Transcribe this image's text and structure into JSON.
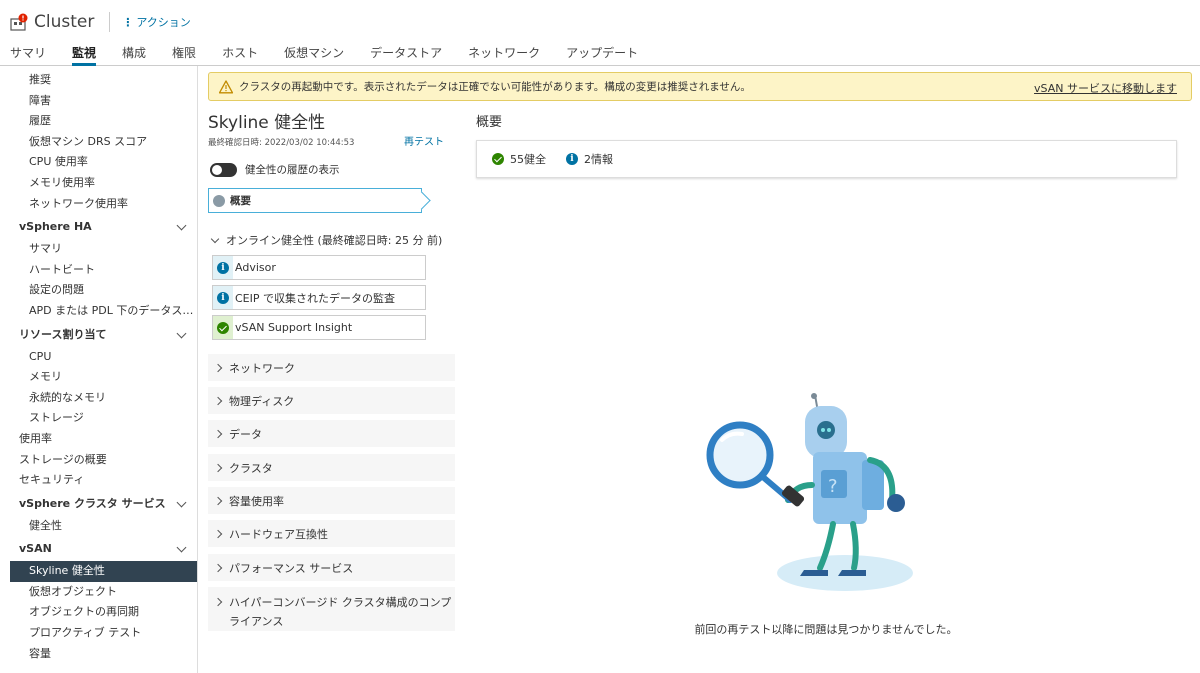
{
  "header": {
    "title": "Cluster",
    "actions_label": "アクション",
    "tabs": [
      {
        "label": "サマリ",
        "active": false
      },
      {
        "label": "監視",
        "active": true
      },
      {
        "label": "構成",
        "active": false
      },
      {
        "label": "権限",
        "active": false
      },
      {
        "label": "ホスト",
        "active": false
      },
      {
        "label": "仮想マシン",
        "active": false
      },
      {
        "label": "データストア",
        "active": false
      },
      {
        "label": "ネットワーク",
        "active": false
      },
      {
        "label": "アップデート",
        "active": false
      }
    ]
  },
  "sidebar": {
    "items_top": [
      "推奨",
      "障害",
      "履歴",
      "仮想マシン DRS スコア",
      "CPU 使用率",
      "メモリ使用率",
      "ネットワーク使用率"
    ],
    "section_ha": "vSphere HA",
    "items_ha": [
      "サマリ",
      "ハートビート",
      "設定の問題",
      "APD または PDL 下のデータストア"
    ],
    "section_resource": "リソース割り当て",
    "items_resource": [
      "CPU",
      "メモリ",
      "永続的なメモリ",
      "ストレージ"
    ],
    "items_misc": [
      "使用率",
      "ストレージの概要",
      "セキュリティ"
    ],
    "section_cluster_services": "vSphere クラスタ サービス",
    "items_cluster_services": [
      "健全性"
    ],
    "section_vsan": "vSAN",
    "items_vsan": [
      "Skyline 健全性",
      "仮想オブジェクト",
      "オブジェクトの再同期",
      "プロアクティブ テスト",
      "容量"
    ],
    "selected": "Skyline 健全性"
  },
  "banner": {
    "message": "クラスタの再起動中です。表示されたデータは正確でない可能性があります。構成の変更は推奨されません。",
    "link": "vSAN サービスに移動します",
    "color": "#fdf4c7"
  },
  "health": {
    "title": "Skyline 健全性",
    "last_checked": "最終確認日時: 2022/03/02 10:44:53",
    "retest": "再テスト",
    "history_toggle": "健全性の履歴の表示",
    "overview": "概要",
    "online_header": "オンライン健全性 (最終確認日時: 25 分 前)",
    "online_checks": [
      {
        "label": "Advisor",
        "status": "info"
      },
      {
        "label": "CEIP で収集されたデータの監査",
        "status": "info"
      },
      {
        "label": "vSAN Support Insight",
        "status": "ok"
      }
    ],
    "groups": [
      "ネットワーク",
      "物理ディスク",
      "データ",
      "クラスタ",
      "容量使用率",
      "ハードウェア互換性",
      "パフォーマンス サービス",
      "ハイパーコンバージド クラスタ構成のコンプライアンス"
    ]
  },
  "summary": {
    "title": "概要",
    "healthy": "55健全",
    "info": "2情報",
    "no_issues": "前回の再テスト以降に問題は見つかりませんでした。"
  },
  "colors": {
    "accent": "#0072a3",
    "ok": "#2e8500",
    "selected_bg": "#314351"
  }
}
